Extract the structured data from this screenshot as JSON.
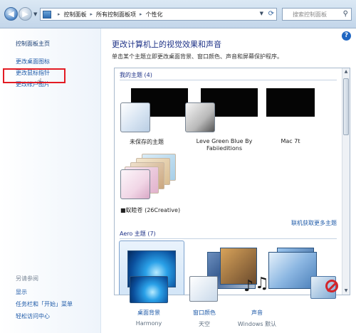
{
  "address_bar": {
    "crumbs": [
      "控制面板",
      "所有控制面板项",
      "个性化"
    ],
    "search_placeholder": "搜索控制面板"
  },
  "left_pane": {
    "home": "控制面板主页",
    "links": [
      "更改桌面图标",
      "更改鼠标指针",
      "更改帐户图片"
    ],
    "see_also_title": "另请参阅",
    "see_also": [
      "显示",
      "任务栏和「开始」菜单",
      "轻松访问中心"
    ],
    "highlighted_link": "更改鼠标指针"
  },
  "main": {
    "title": "更改计算机上的视觉效果和声音",
    "subtitle": "单击某个主题立即更改桌面背景、窗口颜色、声音和屏幕保护程序。",
    "my_themes_header": "我的主题 (4)",
    "themes": [
      {
        "name": "未保存的主题"
      },
      {
        "name": "Leve Green Blue By\nFabiieditions"
      },
      {
        "name": "Mac 7t"
      },
      {
        "name": "■蚁睦苍 (26Creative)"
      }
    ],
    "online_link": "联机获取更多主题",
    "aero_header": "Aero 主题 (7)"
  },
  "bottom_bar": {
    "items": [
      {
        "label": "桌面背景",
        "sub": "Harmony"
      },
      {
        "label": "窗口颜色",
        "sub": "天空"
      },
      {
        "label": "声音",
        "sub": "Windows 默认"
      },
      {
        "label": "",
        "sub": ""
      }
    ]
  },
  "colors": {
    "accent": "#1e5aa8",
    "title": "#1e3287",
    "highlight_box": "#e31b23"
  }
}
